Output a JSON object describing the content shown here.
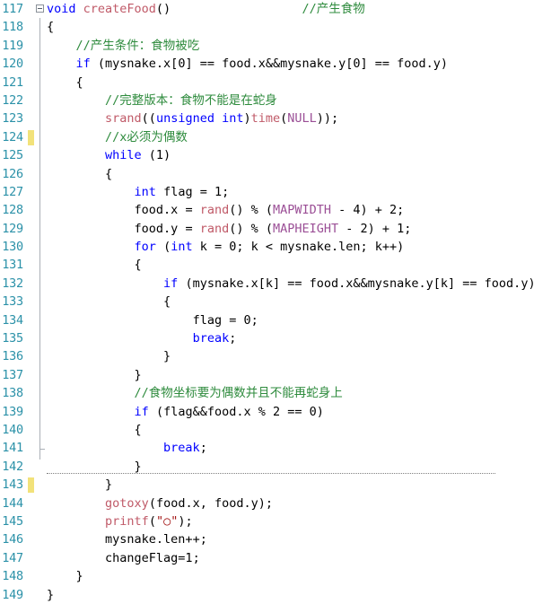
{
  "editor": {
    "name": "code-editor",
    "language": "C",
    "first_line": 117,
    "last_line": 149,
    "colors": {
      "background": "#ffffff",
      "line_number": "#2b91a8",
      "keyword": "#0000ff",
      "function": "#c05a68",
      "comment": "#2e8b3d",
      "macro": "#9b4f96",
      "string": "#a31515",
      "change_marker": "#f2e27a",
      "fold_line": "#aab0b6"
    },
    "fold_marker": "collapse-minus-box",
    "changed_lines": [
      124,
      143
    ]
  },
  "lines": [
    {
      "num": "117",
      "changed": false,
      "indent": 0,
      "tokens": [
        {
          "t": "void ",
          "c": "kw"
        },
        {
          "t": "createFood",
          "c": "fn"
        },
        {
          "t": "()",
          "c": "pln"
        },
        {
          "t": "                  ",
          "c": "pln"
        },
        {
          "t": "//产生食物",
          "c": "cmt"
        }
      ]
    },
    {
      "num": "118",
      "changed": false,
      "indent": 0,
      "tokens": [
        {
          "t": "{",
          "c": "pln"
        }
      ]
    },
    {
      "num": "119",
      "changed": false,
      "indent": 1,
      "tokens": [
        {
          "t": "//产生条件：食物被吃",
          "c": "cmt"
        }
      ]
    },
    {
      "num": "120",
      "changed": false,
      "indent": 1,
      "tokens": [
        {
          "t": "if",
          "c": "kw"
        },
        {
          "t": " (mysnake.x[0] == food.x&&mysnake.y[0] == food.y)",
          "c": "pln"
        }
      ]
    },
    {
      "num": "121",
      "changed": false,
      "indent": 1,
      "tokens": [
        {
          "t": "{",
          "c": "pln"
        }
      ]
    },
    {
      "num": "122",
      "changed": false,
      "indent": 2,
      "tokens": [
        {
          "t": "//完整版本：食物不能是在蛇身",
          "c": "cmt"
        }
      ]
    },
    {
      "num": "123",
      "changed": false,
      "indent": 2,
      "tokens": [
        {
          "t": "srand",
          "c": "fn"
        },
        {
          "t": "((",
          "c": "pln"
        },
        {
          "t": "unsigned int",
          "c": "kw"
        },
        {
          "t": ")",
          "c": "pln"
        },
        {
          "t": "time",
          "c": "fn"
        },
        {
          "t": "(",
          "c": "pln"
        },
        {
          "t": "NULL",
          "c": "mac"
        },
        {
          "t": "));",
          "c": "pln"
        }
      ]
    },
    {
      "num": "124",
      "changed": true,
      "indent": 2,
      "tokens": [
        {
          "t": "//x必须为偶数",
          "c": "cmt"
        }
      ]
    },
    {
      "num": "125",
      "changed": false,
      "indent": 2,
      "tokens": [
        {
          "t": "while",
          "c": "kw"
        },
        {
          "t": " (1)",
          "c": "pln"
        }
      ]
    },
    {
      "num": "126",
      "changed": false,
      "indent": 2,
      "tokens": [
        {
          "t": "{",
          "c": "pln"
        }
      ]
    },
    {
      "num": "127",
      "changed": false,
      "indent": 3,
      "tokens": [
        {
          "t": "int",
          "c": "kw"
        },
        {
          "t": " flag = 1;",
          "c": "pln"
        }
      ]
    },
    {
      "num": "128",
      "changed": false,
      "indent": 3,
      "tokens": [
        {
          "t": "food.x = ",
          "c": "pln"
        },
        {
          "t": "rand",
          "c": "fn"
        },
        {
          "t": "() % (",
          "c": "pln"
        },
        {
          "t": "MAPWIDTH",
          "c": "mac"
        },
        {
          "t": " - 4) + 2;",
          "c": "pln"
        }
      ]
    },
    {
      "num": "129",
      "changed": false,
      "indent": 3,
      "tokens": [
        {
          "t": "food.y = ",
          "c": "pln"
        },
        {
          "t": "rand",
          "c": "fn"
        },
        {
          "t": "() % (",
          "c": "pln"
        },
        {
          "t": "MAPHEIGHT",
          "c": "mac"
        },
        {
          "t": " - 2) + 1;",
          "c": "pln"
        }
      ]
    },
    {
      "num": "130",
      "changed": false,
      "indent": 3,
      "tokens": [
        {
          "t": "for",
          "c": "kw"
        },
        {
          "t": " (",
          "c": "pln"
        },
        {
          "t": "int",
          "c": "kw"
        },
        {
          "t": " k = 0; k < mysnake.len; k++)",
          "c": "pln"
        }
      ]
    },
    {
      "num": "131",
      "changed": false,
      "indent": 3,
      "tokens": [
        {
          "t": "{",
          "c": "pln"
        }
      ]
    },
    {
      "num": "132",
      "changed": false,
      "indent": 4,
      "tokens": [
        {
          "t": "if",
          "c": "kw"
        },
        {
          "t": " (mysnake.x[k] == food.x&&mysnake.y[k] == food.y)",
          "c": "pln"
        }
      ]
    },
    {
      "num": "133",
      "changed": false,
      "indent": 4,
      "tokens": [
        {
          "t": "{",
          "c": "pln"
        }
      ]
    },
    {
      "num": "134",
      "changed": false,
      "indent": 5,
      "tokens": [
        {
          "t": "flag = 0;",
          "c": "pln"
        }
      ]
    },
    {
      "num": "135",
      "changed": false,
      "indent": 5,
      "tokens": [
        {
          "t": "break",
          "c": "kw"
        },
        {
          "t": ";",
          "c": "pln"
        }
      ]
    },
    {
      "num": "136",
      "changed": false,
      "indent": 4,
      "tokens": [
        {
          "t": "}",
          "c": "pln"
        }
      ]
    },
    {
      "num": "137",
      "changed": false,
      "indent": 3,
      "tokens": [
        {
          "t": "}",
          "c": "pln"
        }
      ]
    },
    {
      "num": "138",
      "changed": false,
      "indent": 3,
      "tokens": [
        {
          "t": "//食物坐标要为偶数并且不能再蛇身上",
          "c": "cmt"
        }
      ]
    },
    {
      "num": "139",
      "changed": false,
      "indent": 3,
      "tokens": [
        {
          "t": "if",
          "c": "kw"
        },
        {
          "t": " (flag&&food.x % 2 == 0)",
          "c": "pln"
        }
      ]
    },
    {
      "num": "140",
      "changed": false,
      "indent": 3,
      "tokens": [
        {
          "t": "{",
          "c": "pln"
        }
      ]
    },
    {
      "num": "141",
      "changed": false,
      "indent": 4,
      "tokens": [
        {
          "t": "break",
          "c": "kw"
        },
        {
          "t": ";",
          "c": "pln"
        }
      ]
    },
    {
      "num": "142",
      "changed": false,
      "indent": 3,
      "tokens": [
        {
          "t": "}",
          "c": "pln"
        }
      ]
    },
    {
      "num": "143",
      "changed": true,
      "indent": 2,
      "tokens": [
        {
          "t": "}",
          "c": "pln"
        }
      ]
    },
    {
      "num": "144",
      "changed": false,
      "indent": 2,
      "tokens": [
        {
          "t": "gotoxy",
          "c": "fn"
        },
        {
          "t": "(food.x, food.y);",
          "c": "pln"
        }
      ]
    },
    {
      "num": "145",
      "changed": false,
      "indent": 2,
      "tokens": [
        {
          "t": "printf",
          "c": "fn"
        },
        {
          "t": "(",
          "c": "pln"
        },
        {
          "t": "\"○\"",
          "c": "str"
        },
        {
          "t": ");",
          "c": "pln"
        }
      ]
    },
    {
      "num": "146",
      "changed": false,
      "indent": 2,
      "tokens": [
        {
          "t": "mysnake.len++;",
          "c": "pln"
        }
      ]
    },
    {
      "num": "147",
      "changed": false,
      "indent": 2,
      "tokens": [
        {
          "t": "changeFlag=1;",
          "c": "pln"
        }
      ]
    },
    {
      "num": "148",
      "changed": false,
      "indent": 1,
      "tokens": [
        {
          "t": "}",
          "c": "pln"
        }
      ]
    },
    {
      "num": "149",
      "changed": false,
      "indent": 0,
      "tokens": [
        {
          "t": "}",
          "c": "pln"
        }
      ]
    }
  ]
}
